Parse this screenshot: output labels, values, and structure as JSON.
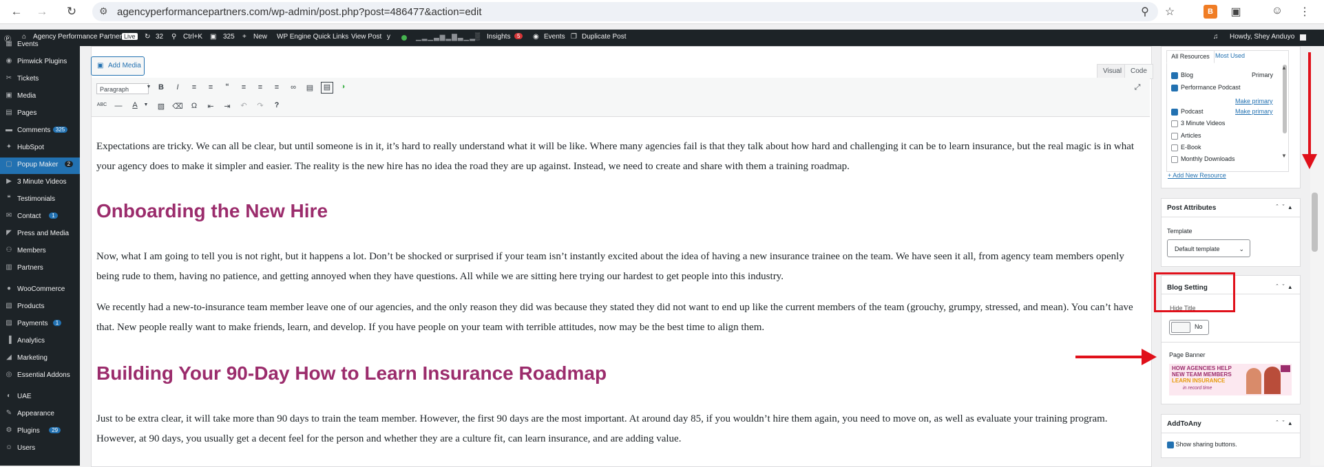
{
  "browser": {
    "url": "agencyperformancepartners.com/wp-admin/post.php?post=486477&action=edit"
  },
  "admin_bar": {
    "site_name": "Agency Performance Partners",
    "live_label": "Live",
    "updates_count": "32",
    "search_shortcut": "Ctrl+K",
    "comments_count": "325",
    "new_label": "New",
    "wp_engine_label": "WP Engine Quick Links",
    "view_post_label": "View Post",
    "insights_label": "Insights",
    "insights_badge": "5",
    "events_label": "Events",
    "duplicate_label": "Duplicate Post",
    "greeting": "Howdy, Shey Anduyo"
  },
  "sidebar": {
    "items": [
      {
        "label": "Events",
        "icon": "calendar-icon",
        "badge": ""
      },
      {
        "label": "Pimwick Plugins",
        "icon": "plug-icon",
        "badge": ""
      },
      {
        "label": "Tickets",
        "icon": "ticket-icon",
        "badge": ""
      },
      {
        "label": "Media",
        "icon": "media-icon",
        "badge": ""
      },
      {
        "label": "Pages",
        "icon": "pages-icon",
        "badge": ""
      },
      {
        "label": "Comments",
        "icon": "comment-icon",
        "badge": "325"
      },
      {
        "label": "HubSpot",
        "icon": "hubspot-icon",
        "badge": ""
      },
      {
        "label": "Popup Maker",
        "icon": "popup-icon",
        "badge": "2"
      },
      {
        "label": "3 Minute Videos",
        "icon": "video-icon",
        "badge": ""
      },
      {
        "label": "Testimonials",
        "icon": "quote-icon",
        "badge": ""
      },
      {
        "label": "Contact",
        "icon": "mail-icon",
        "badge": "1"
      },
      {
        "label": "Press and Media",
        "icon": "megaphone-icon",
        "badge": ""
      },
      {
        "label": "Members",
        "icon": "members-icon",
        "badge": ""
      },
      {
        "label": "Partners",
        "icon": "partners-icon",
        "badge": ""
      },
      {
        "label": "WooCommerce",
        "icon": "woo-icon",
        "badge": ""
      },
      {
        "label": "Products",
        "icon": "products-icon",
        "badge": ""
      },
      {
        "label": "Payments",
        "icon": "payments-icon",
        "badge": "1"
      },
      {
        "label": "Analytics",
        "icon": "analytics-icon",
        "badge": ""
      },
      {
        "label": "Marketing",
        "icon": "marketing-icon",
        "badge": ""
      },
      {
        "label": "Essential Addons",
        "icon": "ea-icon",
        "badge": ""
      },
      {
        "label": "UAE",
        "icon": "uae-icon",
        "badge": ""
      },
      {
        "label": "Appearance",
        "icon": "brush-icon",
        "badge": ""
      },
      {
        "label": "Plugins",
        "icon": "plugins-icon",
        "badge": "29"
      },
      {
        "label": "Users",
        "icon": "users-icon",
        "badge": ""
      }
    ]
  },
  "editor": {
    "add_media": "Add Media",
    "tab_visual": "Visual",
    "tab_code": "Code",
    "format_select": "Paragraph",
    "paragraphs": [
      "Expectations are tricky. We can all be clear, but until someone is in it, it’s hard to really understand what it will be like. Where many agencies fail is that they talk about how hard and challenging it can be to learn insurance, but the real magic is in what your agency does to make it simpler and easier. The reality is the new hire has no idea the road they are up against. Instead, we need to create and share with them a training roadmap.",
      "Now, what I am going to tell you is not right, but it happens a lot. Don’t be shocked or surprised if your team isn’t instantly excited about the idea of having a new insurance trainee on the team. We have seen it all, from agency team members openly being rude to them, having no patience, and getting annoyed when they have questions. All while we are sitting here trying our hardest to get people into this industry.",
      "We recently had a new-to-insurance team member leave one of our agencies, and the only reason they did was because they stated they did not want to end up like the current members of the team (grouchy, grumpy, stressed, and mean). You can’t have that. New people really want to make friends, learn, and develop. If you have people on your team with terrible attitudes, now may be the best time to align them.",
      "Just to be extra clear, it will take more than 90 days to train the team member. However, the first 90 days are the most important. At around day 85, if you wouldn’t hire them again, you need to move on, as well as evaluate your training program. However, at 90 days, you usually get a decent feel for the person and whether they are a culture fit, can learn insurance, and are adding value."
    ],
    "headings": [
      "Onboarding the New Hire",
      "Building Your 90-Day How to Learn Insurance Roadmap"
    ]
  },
  "resources": {
    "tab_all": "All Resources",
    "tab_most_used": "Most Used",
    "items": [
      {
        "label": "Blog",
        "checked": true,
        "extra": "Primary"
      },
      {
        "label": "Performance Podcast",
        "checked": true,
        "extra": ""
      },
      {
        "label": "Podcast",
        "checked": true,
        "extra": "Make primary"
      },
      {
        "label": "3 Minute Videos",
        "checked": false,
        "extra": ""
      },
      {
        "label": "Articles",
        "checked": false,
        "extra": ""
      },
      {
        "label": "E-Book",
        "checked": false,
        "extra": ""
      },
      {
        "label": "Monthly Downloads",
        "checked": false,
        "extra": ""
      }
    ],
    "make_primary_extra": "Make primary",
    "add_new": "+ Add New Resource"
  },
  "post_attributes": {
    "title": "Post Attributes",
    "template_label": "Template",
    "template_value": "Default template"
  },
  "blog_setting": {
    "title": "Blog Setting",
    "hide_title_label": "Hide Title",
    "toggle_value": "No",
    "page_banner_label": "Page Banner",
    "banner_lines": [
      "HOW AGENCIES HELP",
      "NEW TEAM MEMBERS",
      "LEARN INSURANCE",
      "in record time"
    ]
  },
  "addtoany": {
    "title": "AddToAny",
    "show_sharing": "Show sharing buttons."
  },
  "colors": {
    "accent": "#2271b1",
    "heading": "#9b2c6c",
    "annotation_red": "#e0101a"
  }
}
